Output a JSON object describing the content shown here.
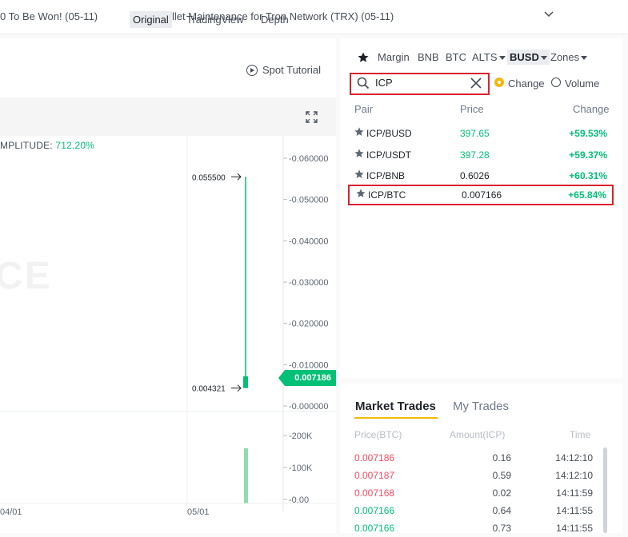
{
  "topbar": {
    "news_1": "0 To Be Won!  (05-11)",
    "news_2": "Wallet Maintenance for Tron Network (TRX)  (05-11)"
  },
  "chart_header": {
    "tutorial": "Spot Tutorial",
    "tabs": [
      "Original",
      "TradingView",
      "Depth"
    ],
    "active_tab": "Original",
    "amplitude_label": "MPLITUDE:",
    "amplitude_value": "712.20%"
  },
  "chart_data": {
    "type": "line",
    "y_ticks": [
      "0.060000",
      "0.050000",
      "0.040000",
      "0.030000",
      "0.020000",
      "0.010000",
      "0.000000"
    ],
    "volume_ticks": [
      "200K",
      "100K",
      "0.00"
    ],
    "x_ticks": [
      "04/01",
      "05/01"
    ],
    "high_label": "0.055500",
    "low_label": "0.004321",
    "current_price": "0.007186",
    "watermark": "CE",
    "candle": {
      "high": 0.0555,
      "low": 0.004321,
      "open": 0.004321,
      "close": 0.007186
    },
    "volume": 160000,
    "ylim": [
      0,
      0.06
    ],
    "volume_lim": [
      0,
      200000
    ],
    "colors": {
      "up": "#02c076",
      "volume": "#8fdcb3"
    }
  },
  "markets": {
    "tabs": [
      "Margin",
      "BNB",
      "BTC",
      "ALTS",
      "BUSD",
      "Zones"
    ],
    "selected": "BUSD",
    "search_value": "ICP",
    "radio_change": "Change",
    "radio_volume": "Volume",
    "col_pair": "Pair",
    "col_price": "Price",
    "col_change": "Change",
    "rows": [
      {
        "pair": "ICP/BUSD",
        "price": "397.65",
        "change": "+59.53%"
      },
      {
        "pair": "ICP/USDT",
        "price": "397.28",
        "change": "+59.37%"
      },
      {
        "pair": "ICP/BNB",
        "price": "0.6026",
        "change": "+60.31%"
      },
      {
        "pair": "ICP/BTC",
        "price": "0.007166",
        "change": "+65.84%"
      }
    ]
  },
  "trades": {
    "tab_market": "Market Trades",
    "tab_my": "My Trades",
    "col_price": "Price(BTC)",
    "col_amount": "Amount(ICP)",
    "col_time": "Time",
    "rows": [
      {
        "price": "0.007186",
        "amount": "0.16",
        "time": "14:12:10",
        "side": "sell"
      },
      {
        "price": "0.007187",
        "amount": "0.59",
        "time": "14:12:10",
        "side": "sell"
      },
      {
        "price": "0.007168",
        "amount": "0.02",
        "time": "14:11:59",
        "side": "sell"
      },
      {
        "price": "0.007166",
        "amount": "0.64",
        "time": "14:11:55",
        "side": "buy"
      },
      {
        "price": "0.007166",
        "amount": "0.73",
        "time": "14:11:55",
        "side": "buy"
      }
    ]
  },
  "colors": {
    "accent": "#f0b90b",
    "up": "#02c076",
    "down": "#f84960",
    "highlight": "#d9232e"
  }
}
